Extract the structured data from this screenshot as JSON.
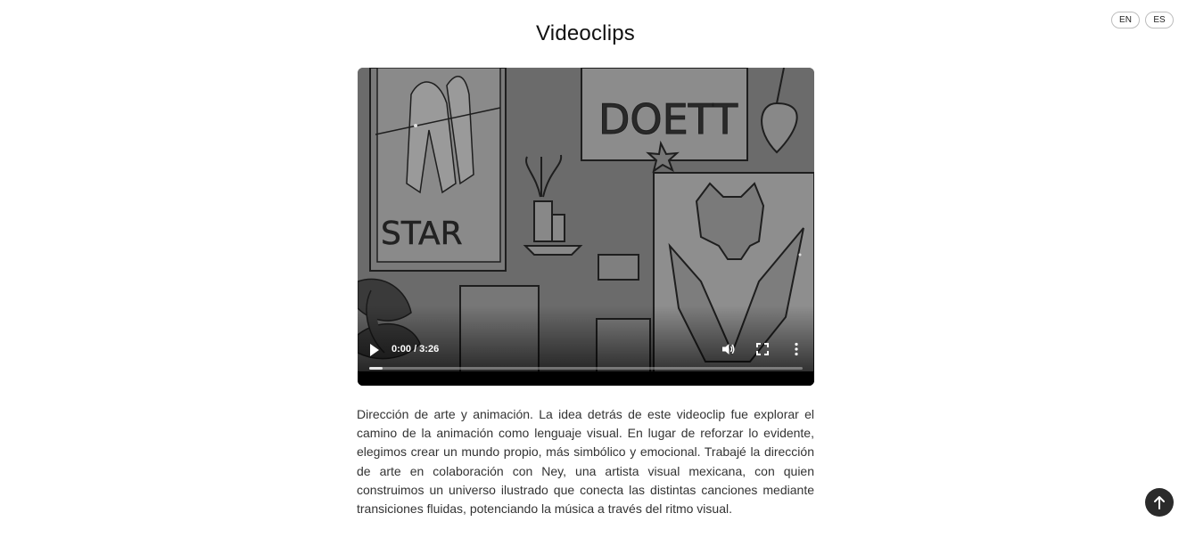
{
  "lang_switch": {
    "en_label": "EN",
    "es_label": "ES"
  },
  "page_title": "Videoclips",
  "video": {
    "time_display": "0:00 / 3:26",
    "progress": 0.03,
    "artwork": {
      "poster_left_text": "STAR",
      "poster_top_text": "DOETT"
    }
  },
  "description": "Dirección de arte y animación. La idea detrás de este videoclip fue explorar el camino de la animación como lenguaje visual. En lugar de reforzar lo evidente, elegimos crear un mundo propio, más simbólico y emocional. Trabajé la dirección de arte en colaboración con Ney, una artista visual mexicana, con quien construimos un universo ilustrado que conecta las distintas canciones mediante transiciones fluidas, potenciando la música a través del ritmo visual.",
  "icons": {
    "play": "play-icon",
    "volume": "volume-icon",
    "fullscreen": "fullscreen-icon",
    "more": "more-options-icon",
    "back_to_top": "arrow-up-icon"
  },
  "colors": {
    "back_to_top_bg": "#2b2b2b",
    "text": "#333333"
  }
}
